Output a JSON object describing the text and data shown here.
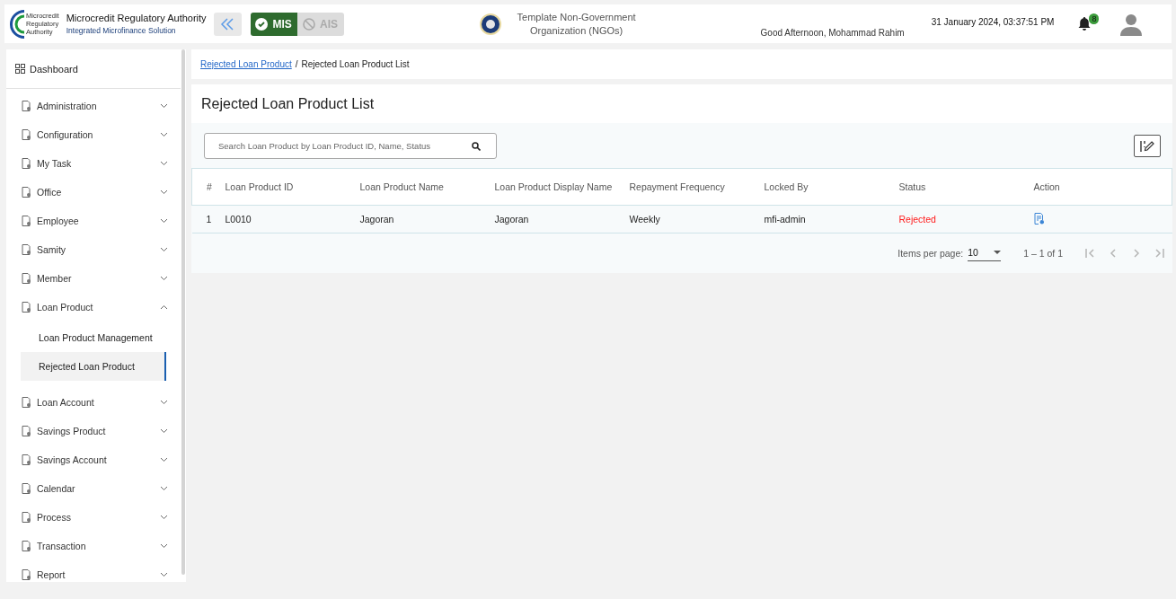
{
  "header": {
    "org_title": "Microcredit Regulatory Authority",
    "org_subtitle": "Integrated Microfinance Solution",
    "logo_text": [
      "Microcredit",
      "Regulatory",
      "Authority"
    ],
    "modules": [
      {
        "label": "MIS",
        "selected": true
      },
      {
        "label": "AIS",
        "selected": false
      }
    ],
    "organization": "Template Non-Government Organization (NGOs)",
    "greeting": "Good Afternoon, Mohammad Rahim",
    "datetime": "31 January 2024, 03:37:51 PM",
    "notification_count": "8"
  },
  "sidebar": {
    "dashboard": "Dashboard",
    "items": [
      {
        "label": "Administration",
        "expanded": false
      },
      {
        "label": "Configuration",
        "expanded": false
      },
      {
        "label": "My Task",
        "expanded": false
      },
      {
        "label": "Office",
        "expanded": false
      },
      {
        "label": "Employee",
        "expanded": false
      },
      {
        "label": "Samity",
        "expanded": false
      },
      {
        "label": "Member",
        "expanded": false
      },
      {
        "label": "Loan Product",
        "expanded": true,
        "children": [
          {
            "label": "Loan Product Management",
            "selected": false
          },
          {
            "label": "Rejected Loan Product",
            "selected": true
          }
        ]
      },
      {
        "label": "Loan Account",
        "expanded": false
      },
      {
        "label": "Savings Product",
        "expanded": false
      },
      {
        "label": "Savings Account",
        "expanded": false
      },
      {
        "label": "Calendar",
        "expanded": false
      },
      {
        "label": "Process",
        "expanded": false
      },
      {
        "label": "Transaction",
        "expanded": false
      },
      {
        "label": "Report",
        "expanded": false
      }
    ]
  },
  "breadcrumb": [
    {
      "label": "Rejected Loan Product",
      "kind": "link"
    },
    {
      "label": "/",
      "kind": "separator"
    },
    {
      "label": "Rejected Loan Product List",
      "kind": "current"
    }
  ],
  "page_title": "Rejected Loan Product List",
  "search": {
    "placeholder": "Search Loan Product by Loan Product ID, Name, Status"
  },
  "table": {
    "columns": [
      "#",
      "Loan Product ID",
      "Loan Product Name",
      "Loan Product Display Name",
      "Repayment Frequency",
      "Locked By",
      "Status",
      "Action"
    ],
    "rows": [
      {
        "cells": [
          "1",
          "L0010",
          "Jagoran",
          "Jagoran",
          "Weekly",
          "mfi-admin",
          "Rejected"
        ],
        "color": "#ff1a1a"
      }
    ]
  },
  "paginator": {
    "label": "Items per page:",
    "page_size": "10",
    "range": "1 – 1 of 1",
    "buttons": [
      {
        "kind": "first",
        "disabled": true
      },
      {
        "kind": "prev",
        "disabled": true
      },
      {
        "kind": "next",
        "disabled": true
      },
      {
        "kind": "last",
        "disabled": true
      }
    ]
  }
}
